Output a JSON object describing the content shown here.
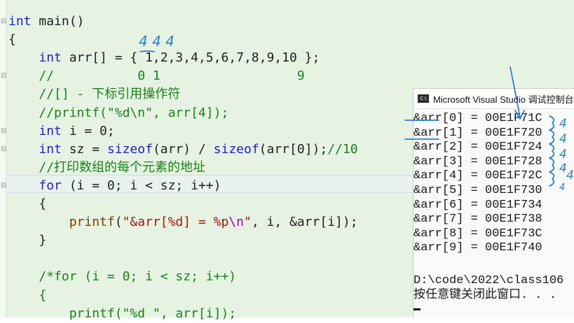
{
  "editor": {
    "lines": [
      {
        "kind": "signature",
        "kw": "int",
        "rest": " main()"
      },
      {
        "kind": "plain",
        "text": "{"
      },
      {
        "kind": "arr",
        "indent": "    ",
        "kw": "int",
        "rest": " arr[] = { 1,2,3,4,5,6,7,8,9,10 };"
      },
      {
        "kind": "comment",
        "indent": "    ",
        "text": "//           0 1                  9"
      },
      {
        "kind": "comment",
        "indent": "    ",
        "text": "//[] - 下标引用操作符"
      },
      {
        "kind": "comment",
        "indent": "    ",
        "text": "//printf(\"%d\\n\", arr[4]);"
      },
      {
        "kind": "decl",
        "indent": "    ",
        "kw": "int",
        "rest": " i = 0;"
      },
      {
        "kind": "sizeof",
        "indent": "    ",
        "kw": "int",
        "a": " sz = ",
        "fn1": "sizeof",
        "b": "(arr) / ",
        "fn2": "sizeof",
        "c": "(arr[0]);",
        "cm": "//10"
      },
      {
        "kind": "comment",
        "indent": "    ",
        "text": "//打印数组的每个元素的地址"
      },
      {
        "kind": "for",
        "indent": "    ",
        "kw": "for",
        "rest": " (i = 0; i < sz; i++)"
      },
      {
        "kind": "plain",
        "indent": "    ",
        "text": "{"
      },
      {
        "kind": "printf",
        "indent": "        ",
        "fn": "printf",
        "p1": "(",
        "s1": "\"&arr[%d] = %p",
        "esc": "\\n",
        "s2": "\"",
        "p2": ", i, &arr[i]);"
      },
      {
        "kind": "plain",
        "indent": "    ",
        "text": "}"
      },
      {
        "kind": "plain",
        "text": ""
      },
      {
        "kind": "comment",
        "indent": "    ",
        "text": "/*for (i = 0; i < sz; i++)"
      },
      {
        "kind": "comment",
        "indent": "    ",
        "text": "{"
      },
      {
        "kind": "comment",
        "indent": "        ",
        "text": "printf(\"%d \", arr[i]);"
      }
    ]
  },
  "console": {
    "icon_text": "C:\\",
    "title": "Microsoft Visual Studio 调试控制台",
    "lines": [
      "&arr[0] = 00E1F71C",
      "&arr[1] = 00E1F720",
      "&arr[2] = 00E1F724",
      "&arr[3] = 00E1F728",
      "&arr[4] = 00E1F72C",
      "&arr[5] = 00E1F730",
      "&arr[6] = 00E1F734",
      "&arr[7] = 00E1F738",
      "&arr[8] = 00E1F73C",
      "&arr[9] = 00E1F740"
    ],
    "path_line": "D:\\code\\2022\\class106",
    "prompt_line": "按任意键关闭此窗口. . ."
  },
  "annotations": {
    "ink_color": "#2a7fd4",
    "top_note": "4 4 4",
    "diff_labels": [
      "4",
      "4",
      "4",
      "4",
      "4",
      "4"
    ]
  }
}
